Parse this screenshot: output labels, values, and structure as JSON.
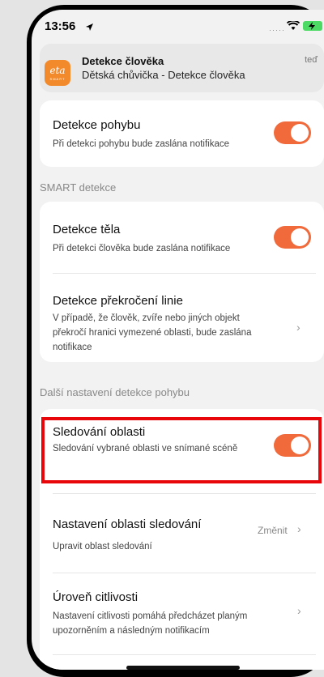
{
  "status": {
    "time": "13:56"
  },
  "notification": {
    "app_logo": "eta",
    "app_logo_sub": "SMART",
    "title": "Detekce člověka",
    "body": "Dětská chůvička - Detekce člověka",
    "time": "teď"
  },
  "motion": {
    "title": "Detekce pohybu",
    "desc": "Při detekci pohybu bude zaslána notifikace",
    "enabled": true
  },
  "smart": {
    "section_label": "SMART detekce",
    "body": {
      "title": "Detekce těla",
      "desc": "Při detekci člověka bude zaslána notifikace",
      "enabled": true
    },
    "line": {
      "title": "Detekce překročení linie",
      "desc": "V případě, že člověk, zvíře nebo jiných objekt překročí hranici vymezené oblasti, bude zaslána notifikace"
    }
  },
  "more": {
    "section_label": "Další nastavení detekce pohybu",
    "tracking": {
      "title": "Sledování oblasti",
      "desc": "Sledování vybrané oblasti ve snímané scéně",
      "enabled": true
    },
    "area": {
      "title": "Nastavení oblasti sledování",
      "desc": "Upravit oblast sledování",
      "action": "Změnit"
    },
    "sensitivity": {
      "title": "Úroveň citlivosti",
      "desc": "Nastavení citlivosti pomáhá předcházet planým upozorněním a následným notifikacím"
    }
  },
  "icons": [
    "location-arrow-icon",
    "signal-icon",
    "wifi-icon",
    "battery-icon",
    "chevron-right-icon"
  ],
  "colors": {
    "accent": "#f06a3c",
    "highlight": "#e8060a",
    "app_icon": "#f28a2c"
  }
}
